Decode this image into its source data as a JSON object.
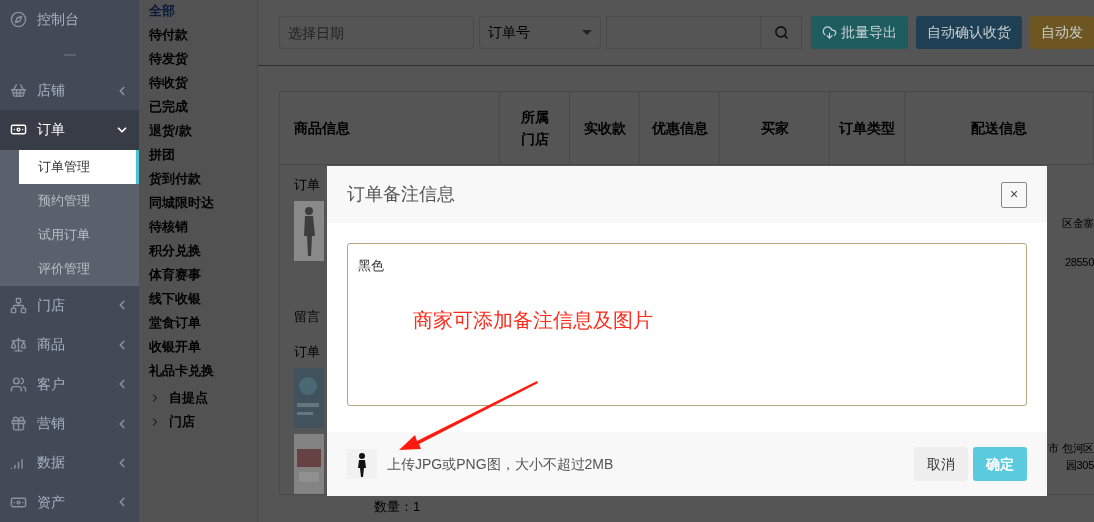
{
  "sidebar": {
    "items": [
      {
        "label": "控制台",
        "kind": "link",
        "expanded": false
      },
      {
        "label": "店铺",
        "kind": "menu",
        "expanded": false
      },
      {
        "label": "订单",
        "kind": "menu",
        "expanded": true,
        "children": [
          {
            "label": "订单管理",
            "selected": true
          },
          {
            "label": "预约管理",
            "selected": false
          },
          {
            "label": "试用订单",
            "selected": false
          },
          {
            "label": "评价管理",
            "selected": false
          }
        ]
      },
      {
        "label": "门店",
        "kind": "menu",
        "expanded": false
      },
      {
        "label": "商品",
        "kind": "menu",
        "expanded": false
      },
      {
        "label": "客户",
        "kind": "menu",
        "expanded": false
      },
      {
        "label": "营销",
        "kind": "menu",
        "expanded": false
      },
      {
        "label": "数据",
        "kind": "menu",
        "expanded": false
      },
      {
        "label": "资产",
        "kind": "menu",
        "expanded": false
      }
    ]
  },
  "filters": {
    "items": [
      {
        "label": "全部",
        "selected": true
      },
      {
        "label": "待付款",
        "selected": false
      },
      {
        "label": "待发货",
        "selected": false
      },
      {
        "label": "待收货",
        "selected": false
      },
      {
        "label": "已完成",
        "selected": false
      },
      {
        "label": "退货/款",
        "selected": false
      },
      {
        "label": "拼团",
        "selected": false
      },
      {
        "label": "货到付款",
        "selected": false
      },
      {
        "label": "同城限时达",
        "selected": false
      },
      {
        "label": "待核销",
        "selected": false
      },
      {
        "label": "积分兑换",
        "selected": false
      },
      {
        "label": "体育赛事",
        "selected": false
      },
      {
        "label": "线下收银",
        "selected": false
      },
      {
        "label": "堂食订单",
        "selected": false
      },
      {
        "label": "收银开单",
        "selected": false
      },
      {
        "label": "礼品卡兑换",
        "selected": false
      }
    ],
    "tree": [
      {
        "label": "自提点",
        "expanded": false
      },
      {
        "label": "门店",
        "expanded": false
      }
    ]
  },
  "toolbar": {
    "date_placeholder": "选择日期",
    "search_type": "订单号",
    "buttons": [
      {
        "label": "批量导出",
        "color": "#1d5c5f"
      },
      {
        "label": "自动确认收货",
        "color": "#1f3f55"
      },
      {
        "label": "自动发",
        "color": "#6e5622"
      }
    ]
  },
  "table": {
    "columns": [
      "商品信息",
      "所属门店",
      "实收款",
      "优惠信息",
      "买家",
      "订单类型",
      "配送信息"
    ],
    "left_texts": [
      "订单",
      "留言",
      "订单"
    ],
    "right_texts": [
      "区金寨",
      "28550",
      "市 包河区",
      "园305"
    ],
    "quantity": "数量：1"
  },
  "dialog": {
    "title": "订单备注信息",
    "close": "×",
    "note": "黑色",
    "annotation": "商家可添加备注信息及图片",
    "upload_hint": "上传JPG或PNG图，大小不超过2MB",
    "cancel": "取消",
    "confirm": "确定"
  }
}
